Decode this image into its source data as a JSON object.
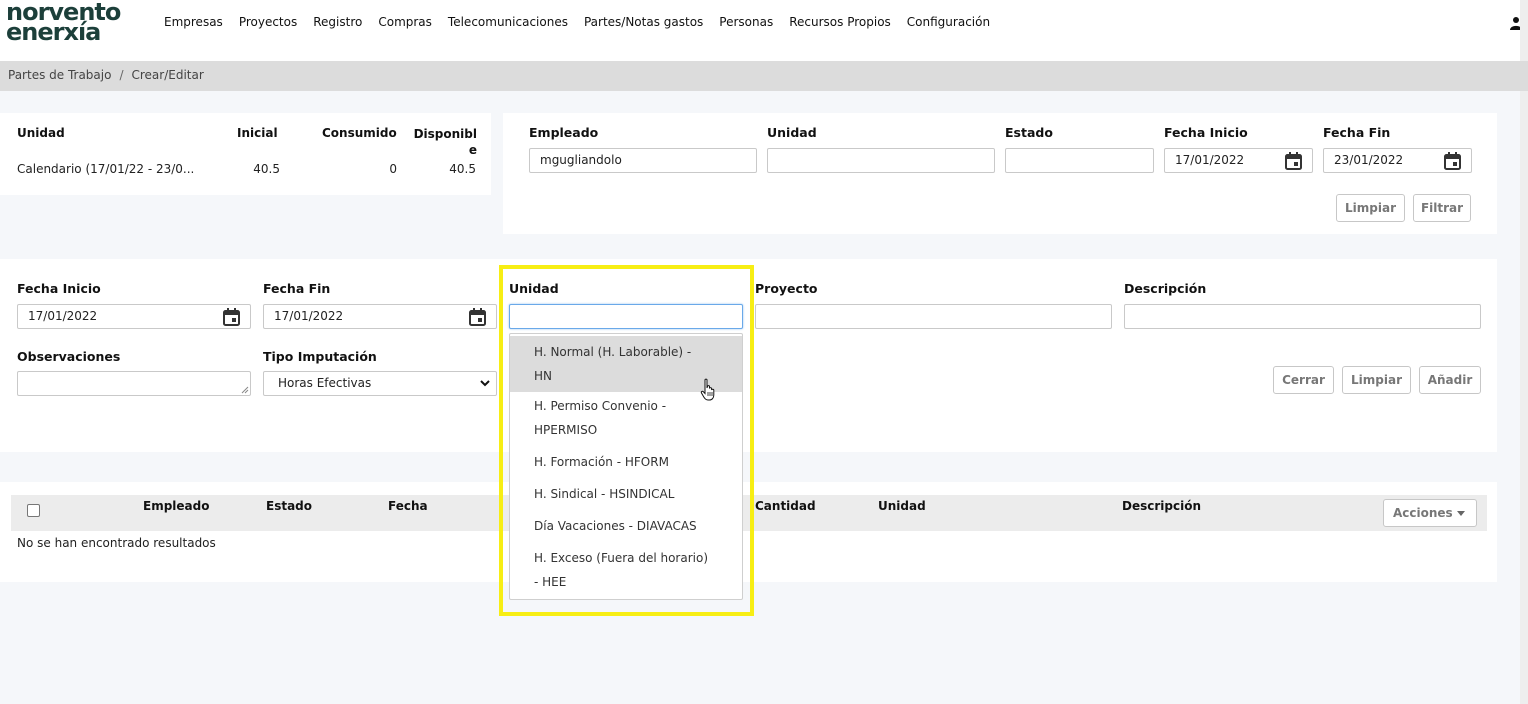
{
  "brand": {
    "line1": "norvento",
    "line2": "enerxía"
  },
  "nav": [
    "Empresas",
    "Proyectos",
    "Registro",
    "Compras",
    "Telecomunicaciones",
    "Partes/Notas gastos",
    "Personas",
    "Recursos Propios",
    "Configuración"
  ],
  "breadcrumb": {
    "item1": "Partes de Trabajo",
    "separator": "/",
    "item2": "Crear/Editar"
  },
  "summary": {
    "headers": {
      "unidad": "Unidad",
      "inicial": "Inicial",
      "consumido": "Consumido",
      "disponible_a": "Disponibl",
      "disponible_b": "e"
    },
    "row": {
      "unidad": "Calendario (17/01/22 - 23/0...",
      "inicial": "40.5",
      "consumido": "0",
      "disponible": "40.5"
    }
  },
  "filters": {
    "empleado_label": "Empleado",
    "empleado_value": "mgugliandolo",
    "unidad_label": "Unidad",
    "unidad_value": "",
    "estado_label": "Estado",
    "estado_value": "",
    "fecha_inicio_label": "Fecha Inicio",
    "fecha_inicio_value": "17/01/2022",
    "fecha_fin_label": "Fecha Fin",
    "fecha_fin_value": "23/01/2022",
    "limpiar": "Limpiar",
    "filtrar": "Filtrar"
  },
  "form": {
    "fecha_inicio_label": "Fecha Inicio",
    "fecha_inicio_value": "17/01/2022",
    "fecha_fin_label": "Fecha Fin",
    "fecha_fin_value": "17/01/2022",
    "unidad_label": "Unidad",
    "unidad_value": "",
    "proyecto_label": "Proyecto",
    "proyecto_value": "",
    "descripcion_label": "Descripción",
    "descripcion_value": "",
    "observaciones_label": "Observaciones",
    "observaciones_value": "",
    "tipo_imputacion_label": "Tipo Imputación",
    "tipo_imputacion_value": "Horas Efectivas",
    "cerrar": "Cerrar",
    "limpiar": "Limpiar",
    "anadir": "Añadir"
  },
  "unidad_dropdown": {
    "options": [
      {
        "line1": "H. Normal (H. Laborable) -",
        "line2": "HN"
      },
      {
        "line1": "H. Permiso Convenio -",
        "line2": "HPERMISO"
      },
      {
        "line1": "H. Formación - HFORM",
        "line2": ""
      },
      {
        "line1": "H. Sindical - HSINDICAL",
        "line2": ""
      },
      {
        "line1": "Día Vacaciones - DIAVACAS",
        "line2": ""
      },
      {
        "line1": "H. Exceso (Fuera del horario)",
        "line2": "- HEE"
      }
    ]
  },
  "table": {
    "headers": {
      "empleado": "Empleado",
      "estado": "Estado",
      "fecha": "Fecha",
      "cantidad": "Cantidad",
      "unidad": "Unidad",
      "descripcion": "Descripción"
    },
    "acciones": "Acciones",
    "empty_message": "No se han encontrado resultados"
  },
  "colors": {
    "highlight": "#f7ee14",
    "brand": "#1c3f3a"
  }
}
